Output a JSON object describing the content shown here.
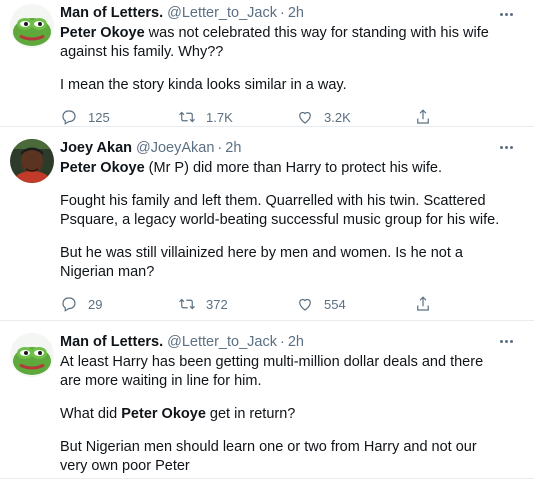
{
  "tweets": [
    {
      "name": "Man of Letters.",
      "handle": "@Letter_to_Jack",
      "dot": "·",
      "time": "2h",
      "avatar": "pepe-frog",
      "paragraphs": [
        [
          {
            "b": "Peter Okoye"
          },
          {
            "t": " was not celebrated this way for standing with his wife against his family. Why??"
          }
        ],
        [
          {
            "t": "I mean the story kinda looks similar in a way."
          }
        ]
      ],
      "replies": "125",
      "retweets": "1.7K",
      "likes": "3.2K"
    },
    {
      "name": "Joey Akan",
      "handle": "@JoeyAkan",
      "dot": "·",
      "time": "2h",
      "avatar": "person-photo",
      "paragraphs": [
        [
          {
            "b": "Peter Okoye"
          },
          {
            "t": " (Mr P) did more than Harry to protect his wife."
          }
        ],
        [
          {
            "t": "Fought his family and left them. Quarrelled with his twin. Scattered Psquare, a legacy world-beating successful music group for his wife."
          }
        ],
        [
          {
            "t": "But he was still villainized here by men and women. Is he not a Nigerian man?"
          }
        ]
      ],
      "replies": "29",
      "retweets": "372",
      "likes": "554"
    },
    {
      "name": "Man of Letters.",
      "handle": "@Letter_to_Jack",
      "dot": "·",
      "time": "2h",
      "avatar": "pepe-frog",
      "paragraphs": [
        [
          {
            "t": "At least Harry has been getting multi-million dollar deals and there are more waiting in line for him."
          }
        ],
        [
          {
            "t": "What did "
          },
          {
            "b": "Peter Okoye"
          },
          {
            "t": " get in return?"
          }
        ],
        [
          {
            "t": "But Nigerian men should learn one or two from Harry and not our very own poor Peter"
          }
        ]
      ]
    }
  ],
  "colors": {
    "text": "#0f1419",
    "secondary": "#5b7083",
    "divider": "#e6ecf0",
    "frog_green": "#5da93c"
  },
  "icons": [
    "reply-icon",
    "retweet-icon",
    "like-icon",
    "share-icon",
    "more-icon"
  ]
}
